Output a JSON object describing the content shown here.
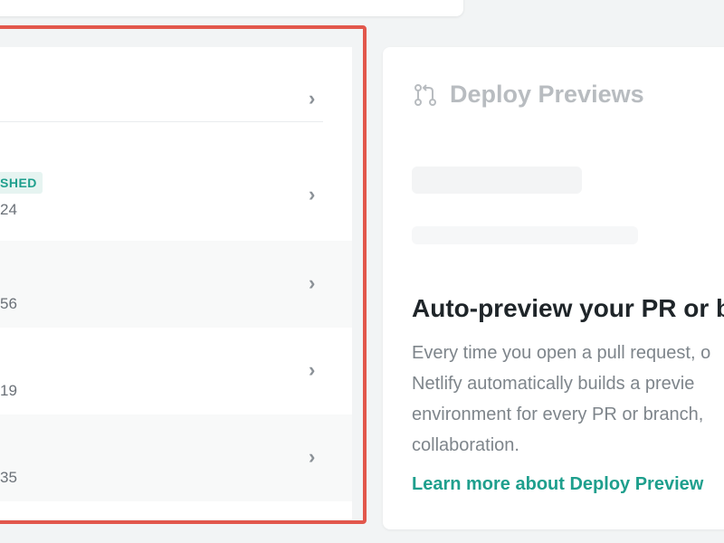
{
  "left_list": {
    "badge": "SHED",
    "rows": [
      {
        "number": "24"
      },
      {
        "number": "56"
      },
      {
        "number": "19"
      },
      {
        "number": "35"
      }
    ],
    "chevron": "›"
  },
  "deploy_previews": {
    "title": "Deploy Previews",
    "icon": "git-pull-request-icon",
    "heading": "Auto-preview your PR or br",
    "body_lines": [
      "Every time you open a pull request, o",
      "Netlify automatically builds a previe",
      "environment for every PR or branch,",
      "collaboration."
    ],
    "link": "Learn more about Deploy Preview"
  },
  "colors": {
    "accent": "#1e9f8d",
    "highlight": "#e2574c"
  }
}
